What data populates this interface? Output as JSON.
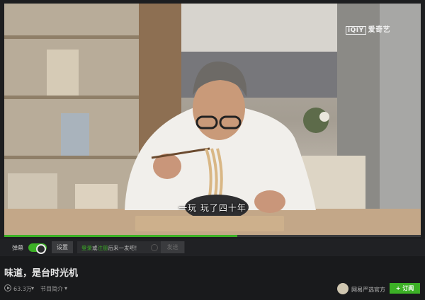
{
  "video": {
    "subtitle": "一玩  玩了四十年",
    "watermark_logo": "iQIY",
    "watermark_text": "爱奇艺",
    "progress_percent": 56
  },
  "controls": {
    "danmu_label": "弹幕",
    "settings_label": "设置",
    "danmu_login": "登录",
    "danmu_or": "或",
    "danmu_register": "注册",
    "danmu_prompt": "后来一发吧！",
    "send_label": "发送"
  },
  "info": {
    "title": "味道，是台时光机",
    "play_count": "63.3万",
    "program_intro": "节目简介",
    "channel_name": "网易严选官方",
    "subscribe_label": "+ 订阅"
  },
  "colors": {
    "accent": "#3cb026",
    "background": "#191a1c"
  }
}
